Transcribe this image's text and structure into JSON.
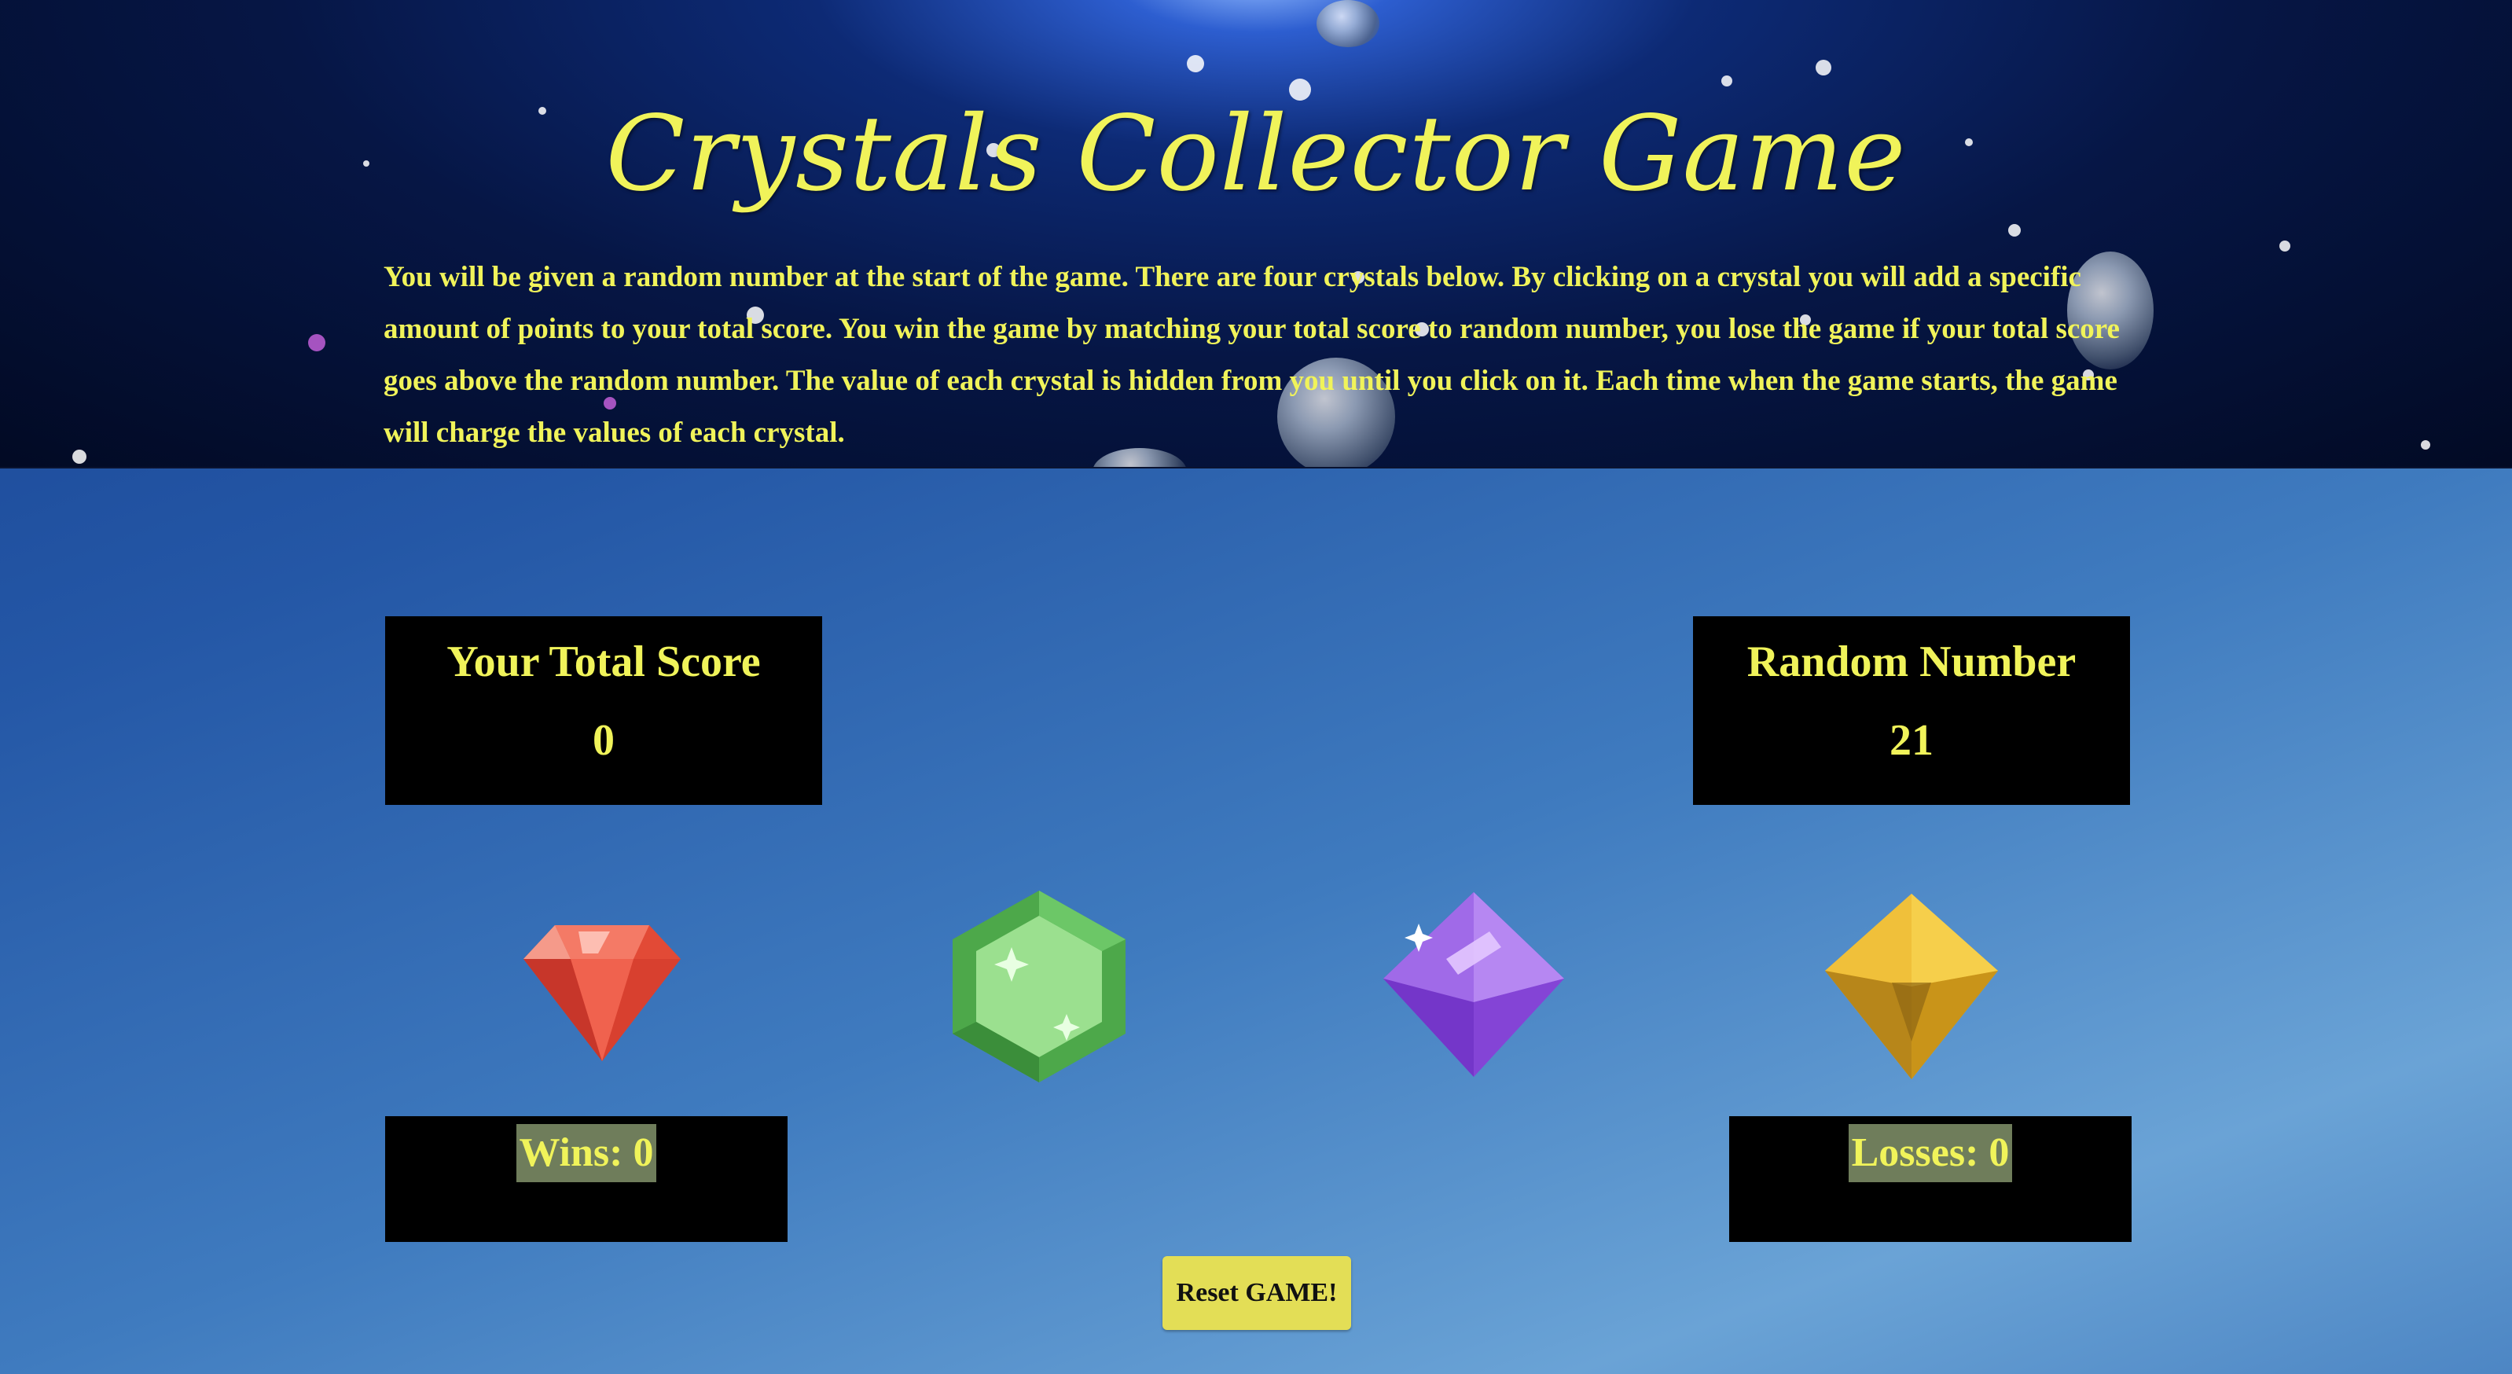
{
  "title": "Crystals Collector Game",
  "instructions": "You will be given a random number at the start of the game. There are four crystals below. By clicking on a crystal you will add a specific amount of points to your total score. You win the game by matching your total score to random number, you lose the game if your total score goes above the random number. The value of each crystal is hidden from you until you click on it. Each time when the game starts, the game will charge the values of each crystal.",
  "score": {
    "label": "Your Total Score",
    "value": "0"
  },
  "target": {
    "label": "Random Number",
    "value": "21"
  },
  "crystals": [
    {
      "name": "red-crystal",
      "color": "#e8483a"
    },
    {
      "name": "green-crystal",
      "color": "#5fbf5a"
    },
    {
      "name": "purple-crystal",
      "color": "#9b5de5"
    },
    {
      "name": "gold-crystal",
      "color": "#e6b02a"
    }
  ],
  "wins": "Wins: 0",
  "losses": "Losses: 0",
  "reset_label": "Reset GAME!",
  "colors": {
    "accent_text": "#f0f35a",
    "box_bg": "#000000",
    "button_bg": "#e3de56"
  }
}
